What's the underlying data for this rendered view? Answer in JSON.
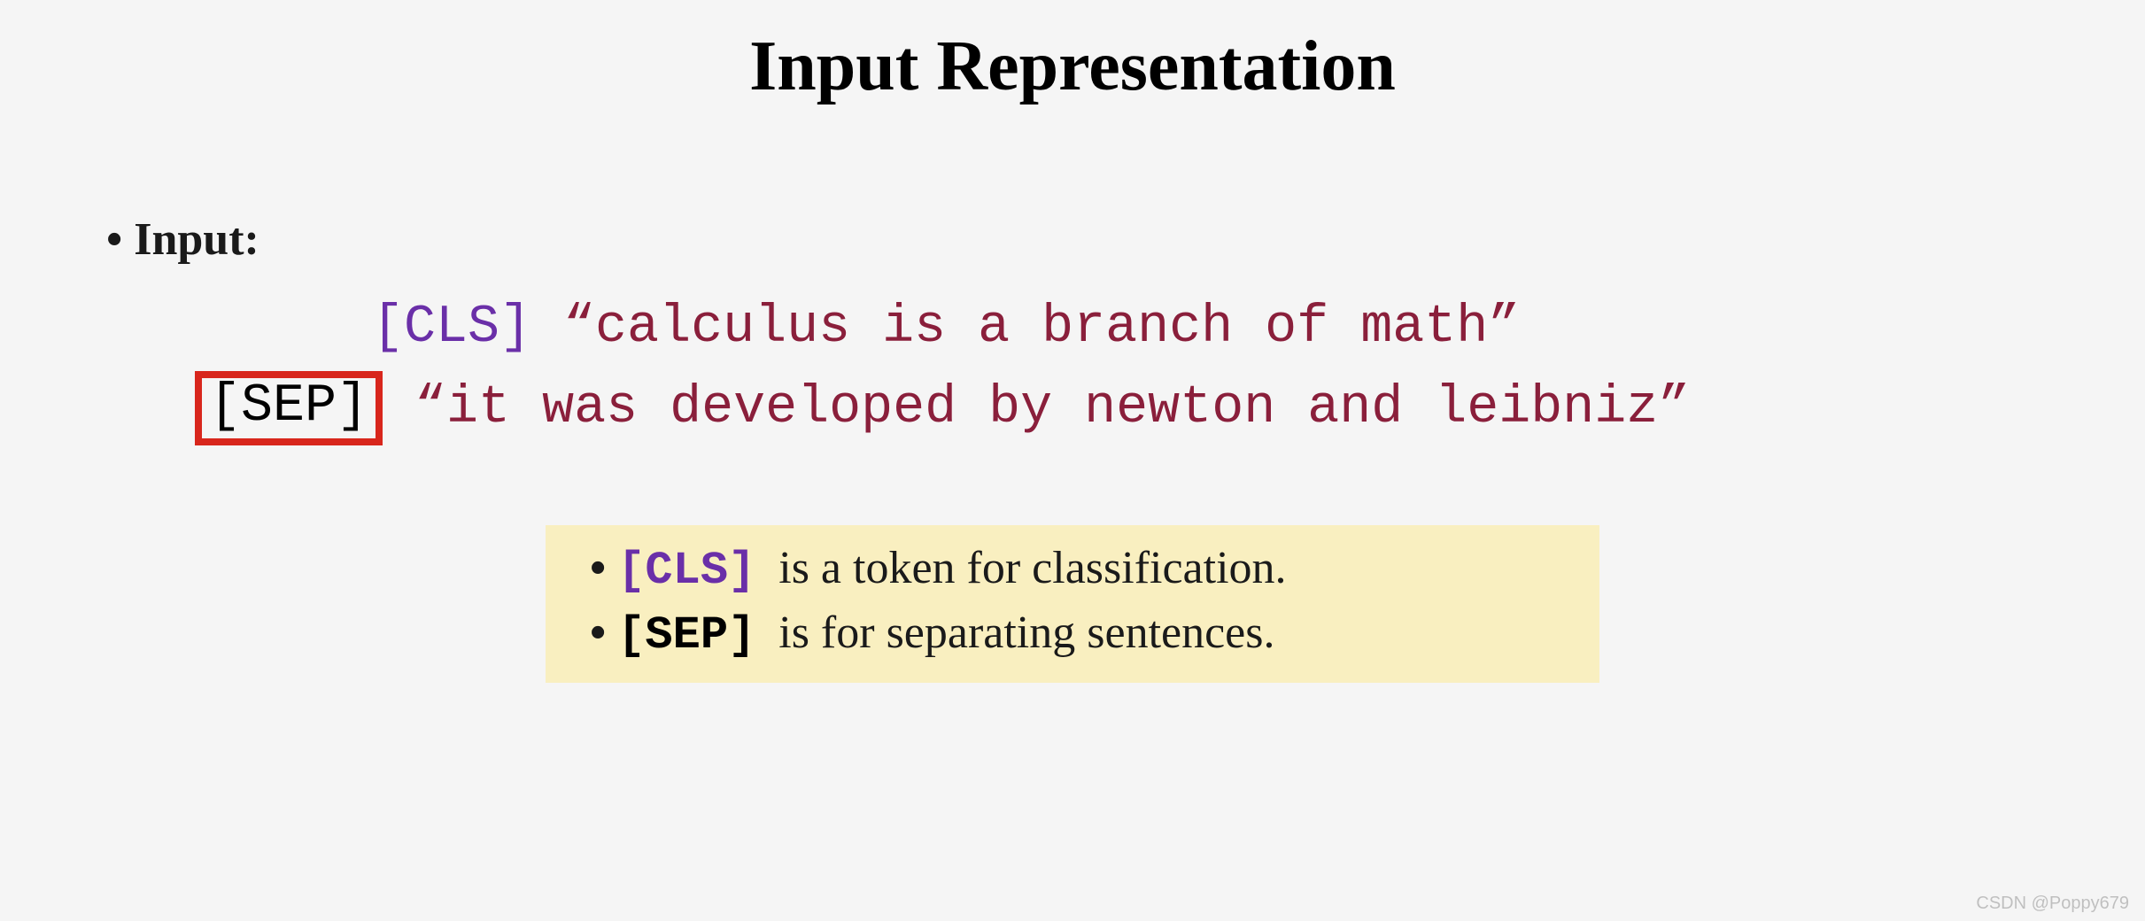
{
  "title": "Input Representation",
  "section_label": "Input:",
  "input": {
    "cls_token": "[CLS]",
    "sentence1": "“calculus is a branch of math”",
    "sep_token": "[SEP]",
    "sentence2": "“it was developed by newton and leibniz”"
  },
  "legend": {
    "cls_token": "[CLS]",
    "cls_desc": " is a token for classification.",
    "sep_token": "[SEP]",
    "sep_desc": " is for separating sentences."
  },
  "watermark": "CSDN @Poppy679"
}
